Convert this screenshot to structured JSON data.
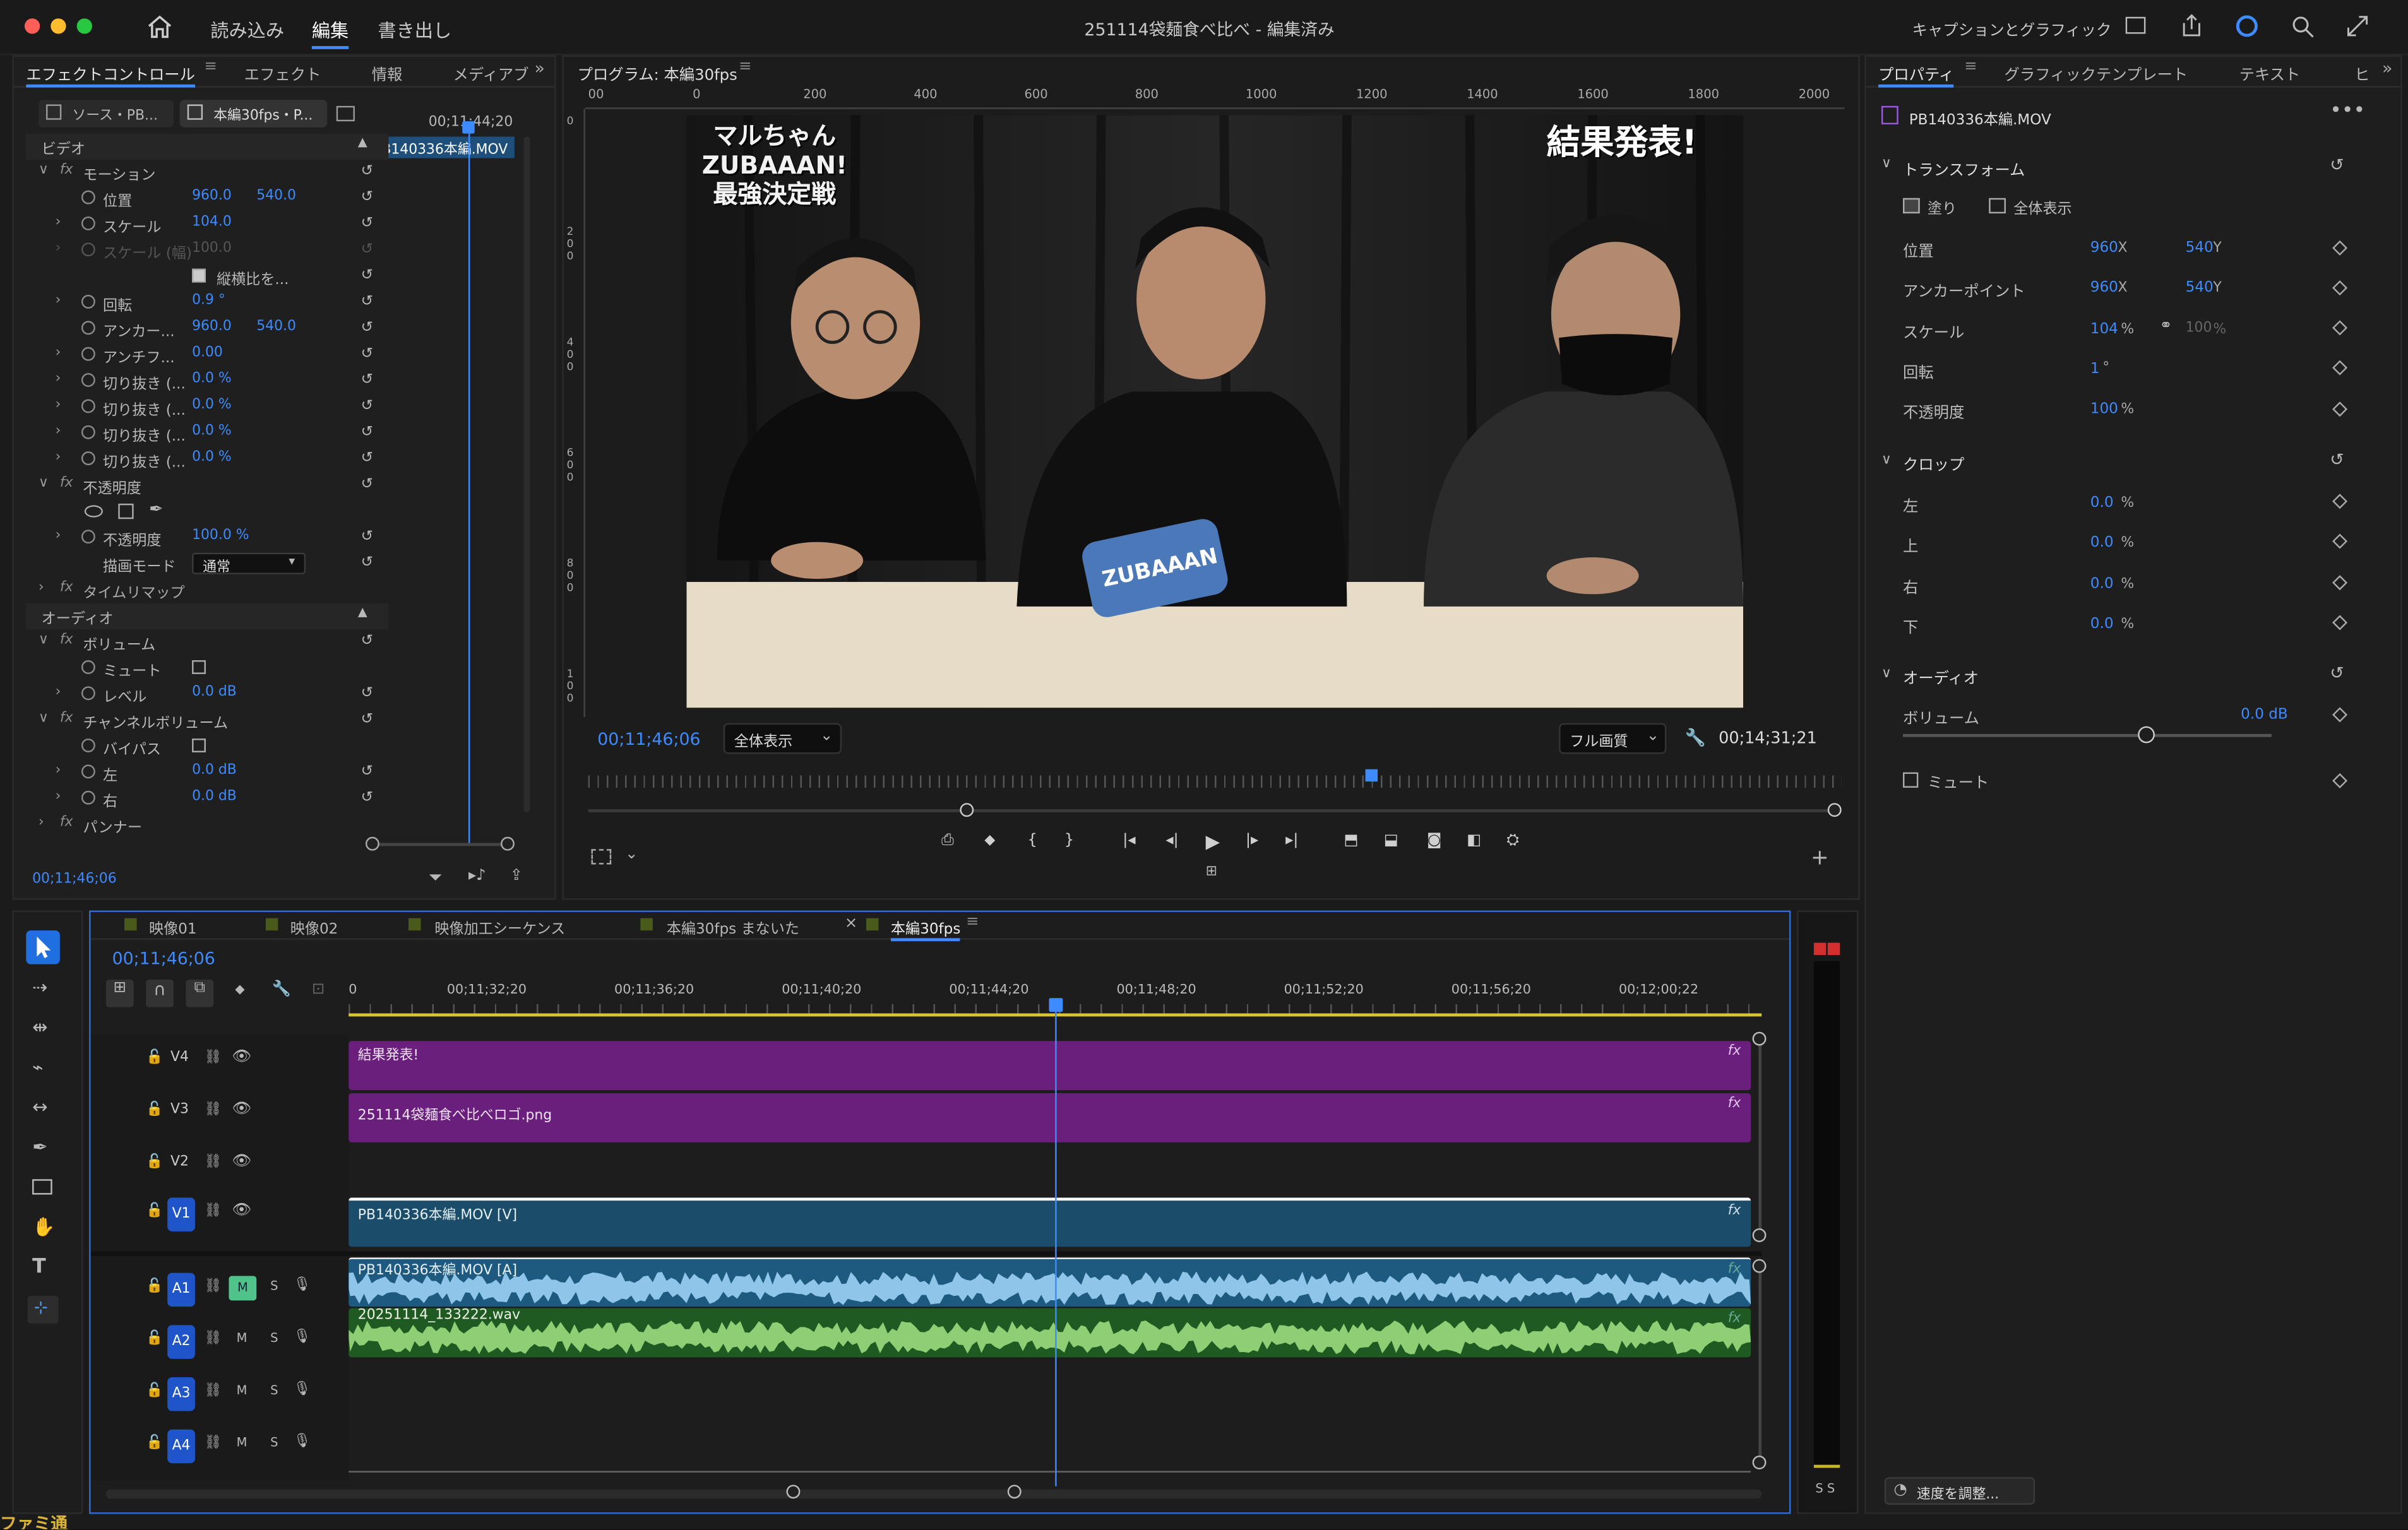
{
  "titlebar": {
    "menus": [
      "読み込み",
      "編集",
      "書き出し"
    ],
    "active": "編集",
    "doc_title": "251114袋麺食べ比べ - 編集済み",
    "right_label": "キャプションとグラフィック"
  },
  "effect_controls": {
    "tabs": [
      "エフェクトコントロール",
      "エフェクト",
      "情報",
      "メディアブ"
    ],
    "source_tab": "ソース・PB...",
    "seq_tab": "本編30fps・P...",
    "mini_time": "00;11;44;20",
    "mini_clip": "PB140336本編.MOV",
    "video_header": "ビデオ",
    "audio_header": "オーディオ",
    "motion": "モーション",
    "pos": "位置",
    "pos_x": "960.0",
    "pos_y": "540.0",
    "scale": "スケール",
    "scale_v": "104.0",
    "scale_w": "スケール (幅)",
    "scale_w_v": "100.0",
    "uniform": "縦横比を...",
    "rotation": "回転",
    "rotation_v": "0.9 °",
    "anchor": "アンカー...",
    "anchor_x": "960.0",
    "anchor_y": "540.0",
    "antiflicker": "アンチフ...",
    "antiflicker_v": "0.00",
    "crop": [
      "切り抜き (...",
      "切り抜き (...",
      "切り抜き (...",
      "切り抜き (..."
    ],
    "crop_v": "0.0 %",
    "opacity": "不透明度",
    "opacity_row": "不透明度",
    "opacity_v": "100.0 %",
    "blend": "描画モード",
    "blend_v": "通常",
    "timeremap": "タイムリマップ",
    "volume": "ボリューム",
    "mute": "ミュート",
    "level": "レベル",
    "level_v": "0.0 dB",
    "chvol": "チャンネルボリューム",
    "bypass": "バイパス",
    "left": "左",
    "left_v": "0.0 dB",
    "right": "右",
    "right_v": "0.0 dB",
    "panner": "パンナー",
    "timecode": "00;11;46;06"
  },
  "program": {
    "title": "プログラム: 本編30fps",
    "ruler": [
      "00",
      "0",
      "200",
      "400",
      "600",
      "800",
      "1000",
      "1200",
      "1400",
      "1600",
      "1800",
      "2000"
    ],
    "vruler": [
      "0",
      "2 0 0",
      "4 0 0",
      "6 0 0",
      "8 0 0",
      "1 0 0"
    ],
    "caption_left": "マルちゃん\nZUBAAAN!\n最強決定戦",
    "caption_right": "結果発表!",
    "timecode": "00;11;46;06",
    "zoom": "全体表示",
    "quality": "フル画質",
    "duration": "00;14;31;21",
    "playhead_pct": 0.62
  },
  "properties": {
    "tabs": [
      "プロパティ",
      "グラフィックテンプレート",
      "テキスト",
      "ヒ"
    ],
    "clip": "PB140336本編.MOV",
    "transform": "トランスフォーム",
    "fill": "塗り",
    "fit": "全体表示",
    "pos": "位置",
    "pos_x": "960",
    "pos_y": "540",
    "anchor": "アンカーポイント",
    "anchor_x": "960",
    "anchor_y": "540",
    "scale": "スケール",
    "scale_v": "104",
    "scale_w": "100",
    "rotation": "回転",
    "rotation_v": "1",
    "opacity": "不透明度",
    "opacity_v": "100",
    "crop": "クロップ",
    "crop_left": "左",
    "crop_top": "上",
    "crop_right": "右",
    "crop_bottom": "下",
    "crop_v": "0.0",
    "audio": "オーディオ",
    "volume": "ボリューム",
    "volume_v": "0.0 dB",
    "mute": "ミュート",
    "speed_btn": "速度を調整...",
    "u_x": "X",
    "u_y": "Y",
    "u_pct": "%",
    "u_deg": "°"
  },
  "timeline": {
    "tabs": [
      "映像01",
      "映像02",
      "映像加工シーケンス",
      "本編30fps まないた",
      "本編30fps"
    ],
    "active": "本編30fps",
    "timecode": "00;11;46;06",
    "ruler": [
      "0",
      "00;11;32;20",
      "00;11;36;20",
      "00;11;40;20",
      "00;11;44;20",
      "00;11;48;20",
      "00;11;52;20",
      "00;11;56;20",
      "00;12;00;22"
    ],
    "video_tracks": [
      "V4",
      "V3",
      "V2",
      "V1"
    ],
    "audio_tracks": [
      "A1",
      "A2",
      "A3",
      "A4"
    ],
    "clips": {
      "v4": "結果発表!",
      "v3": "251114袋麺食べ比べロゴ.png",
      "v1": "PB140336本編.MOV [V]",
      "a1": "PB140336本編.MOV [A]",
      "a2": "20251114_133222.wav"
    },
    "m": "M",
    "s": "S",
    "playhead_pct": 0.5,
    "meter_label": "S S",
    "fx": "fx"
  }
}
